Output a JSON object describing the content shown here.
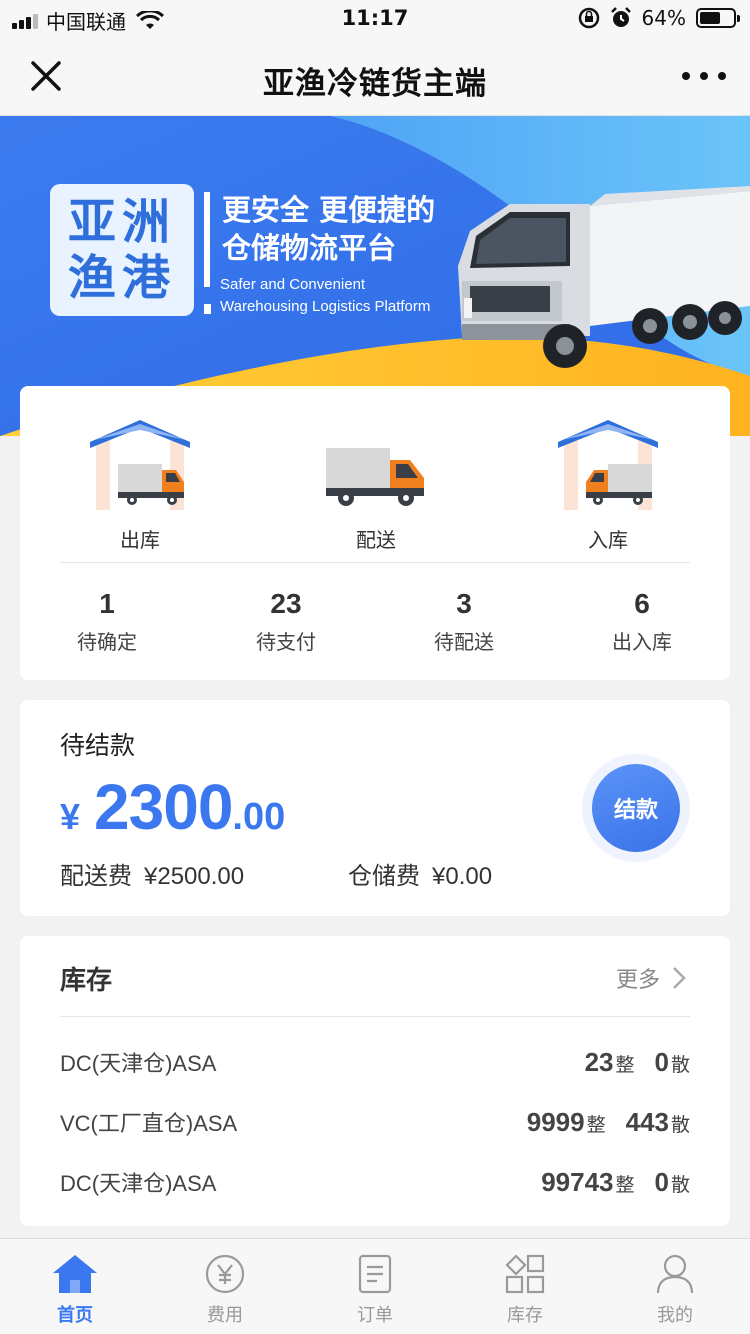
{
  "status_bar": {
    "carrier": "中国联通",
    "time": "11:17",
    "battery": "64%",
    "battery_level": 0.64
  },
  "nav": {
    "title": "亚渔冷链货主端"
  },
  "banner": {
    "logo_line1": "亚洲",
    "logo_line2": "渔港",
    "slogan_line1": "更安全 更便捷的",
    "slogan_line2": "仓储物流平台",
    "slogan_en_line1": "Safer and Convenient",
    "slogan_en_line2": "Warehousing Logistics Platform"
  },
  "actions": [
    {
      "label": "出库",
      "icon": "warehouse-out-icon"
    },
    {
      "label": "配送",
      "icon": "delivery-truck-icon"
    },
    {
      "label": "入库",
      "icon": "warehouse-in-icon"
    }
  ],
  "stats": [
    {
      "value": "1",
      "label": "待确定"
    },
    {
      "value": "23",
      "label": "待支付"
    },
    {
      "value": "3",
      "label": "待配送"
    },
    {
      "value": "6",
      "label": "出入库"
    }
  ],
  "payment": {
    "title": "待结款",
    "currency": "¥",
    "amount_int": "2300",
    "amount_dec": ".00",
    "delivery_fee_label": "配送费",
    "delivery_fee_value": "¥2500.00",
    "storage_fee_label": "仓储费",
    "storage_fee_value": "¥0.00",
    "pay_button": "结款"
  },
  "inventory": {
    "title": "库存",
    "more_label": "更多",
    "whole_unit": "整",
    "loose_unit": "散",
    "rows": [
      {
        "name": "DC(天津仓)ASA",
        "whole": "23",
        "loose": "0"
      },
      {
        "name": "VC(工厂直仓)ASA",
        "whole": "9999",
        "loose": "443"
      },
      {
        "name": "DC(天津仓)ASA",
        "whole": "99743",
        "loose": "0"
      }
    ]
  },
  "tabbar": {
    "active_color": "#3b78f0",
    "items": [
      {
        "label": "首页",
        "icon": "home-icon",
        "active": true
      },
      {
        "label": "费用",
        "icon": "yuan-icon",
        "active": false
      },
      {
        "label": "订单",
        "icon": "document-icon",
        "active": false
      },
      {
        "label": "库存",
        "icon": "grid-icon",
        "active": false
      },
      {
        "label": "我的",
        "icon": "user-icon",
        "active": false
      }
    ]
  }
}
